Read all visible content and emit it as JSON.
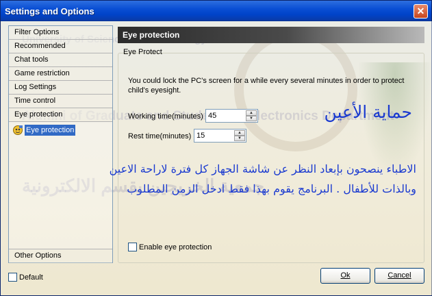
{
  "window": {
    "title": "Settings and Options",
    "close_glyph": "✕"
  },
  "nav": {
    "items": [
      {
        "label": "Filter Options"
      },
      {
        "label": "Recommended"
      },
      {
        "label": "Chat tools"
      },
      {
        "label": "Game restriction"
      },
      {
        "label": "Log Settings"
      },
      {
        "label": "Time control"
      },
      {
        "label": "Eye protection"
      }
    ],
    "selected_subitem": "Eye protection",
    "other_options": "Other Options"
  },
  "panel": {
    "header": "Eye protection",
    "group_title": "Eye Protect",
    "description": "You could lock the PC's screen for a while every several minutes in order to protect child's eyesight.",
    "working_time_label": "Working time(minutes)",
    "working_time_value": "45",
    "rest_time_label": "Rest time(minutes)",
    "rest_time_value": "15",
    "enable_label": "Enable eye protection",
    "enable_checked": false
  },
  "annotations": {
    "title_ar": "حماية الأعين",
    "line1_ar": "الاطباء ينصحون بإبعاد النظر عن شاشة الجهاز كل فترة لاراحة الاعين",
    "line2_ar": "وبالذات للأطفال . البرنامج يقوم بهذا فقط ادخل الزمن المطلوب"
  },
  "footer": {
    "default_label": "Default",
    "default_checked": false,
    "ok_label": "Ok",
    "cancel_label": "Cancel"
  },
  "watermark": {
    "line1": "Alumni of Graduate and Students of Electronics Department",
    "line2": "University of Science and Technology",
    "line3": "جمعية الخريجين بقسم الالكترونية"
  },
  "colors": {
    "title_bar": "#0a4fd4",
    "selection": "#316ac5",
    "arabic_text": "#1a3ad0",
    "panel_header": "#2b2b2b"
  }
}
